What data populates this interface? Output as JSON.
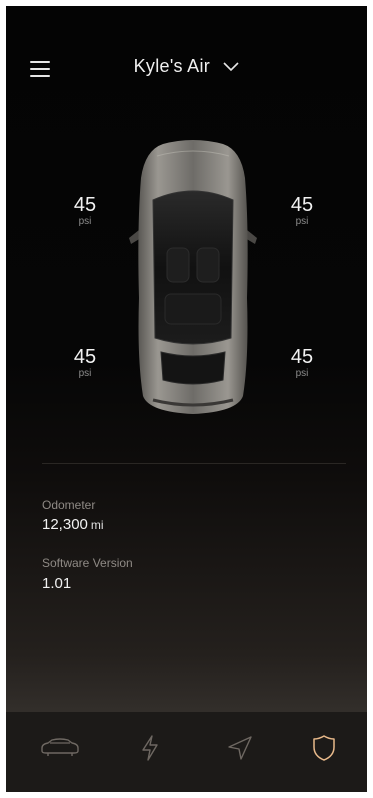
{
  "header": {
    "title": "Kyle's Air"
  },
  "tires": {
    "front_left": {
      "value": "45",
      "unit": "psi"
    },
    "front_right": {
      "value": "45",
      "unit": "psi"
    },
    "rear_left": {
      "value": "45",
      "unit": "psi"
    },
    "rear_right": {
      "value": "45",
      "unit": "psi"
    }
  },
  "info": {
    "odometer_label": "Odometer",
    "odometer_value": "12,300",
    "odometer_unit": "mi",
    "software_label": "Software Version",
    "software_value": "1.01"
  },
  "tabs": [
    {
      "icon": "car-icon"
    },
    {
      "icon": "lightning-icon"
    },
    {
      "icon": "navigation-icon"
    },
    {
      "icon": "shield-icon",
      "active": true
    }
  ],
  "colors": {
    "accent": "#e8b98a",
    "tab_inactive": "#6e6862"
  }
}
